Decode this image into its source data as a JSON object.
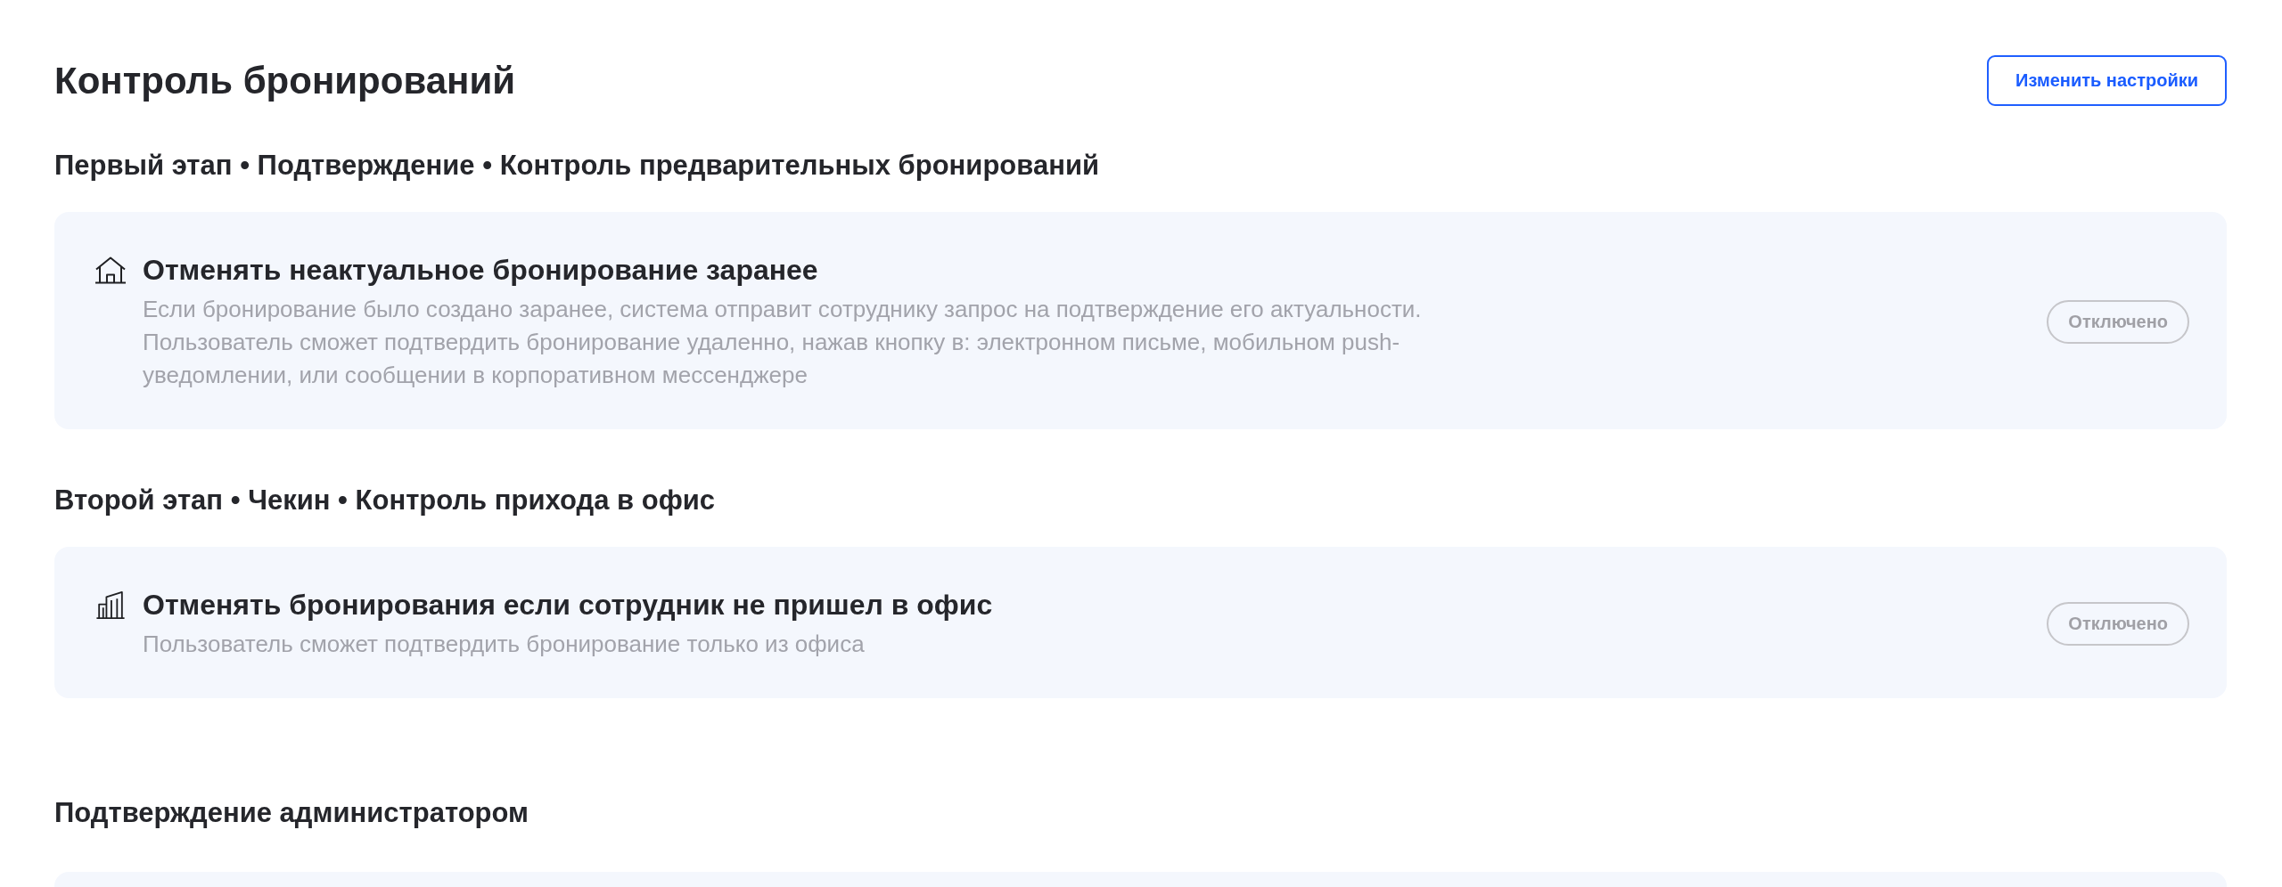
{
  "page": {
    "title": "Контроль бронирований",
    "action_button": "Изменить настройки"
  },
  "stages": [
    {
      "heading": "Первый этап • Подтверждение • Контроль предварительных бронирований",
      "cards": [
        {
          "kind": "remote",
          "title": "Отменять неактуальное бронирование заранее",
          "description": "Если бронирование было создано заранее, система отправит сотруднику запрос на подтверждение его актуальности. Пользователь сможет подтвердить бронирование удаленно, нажав кнопку в: электронном письме, мобильном push-уведомлении, или сообщении в корпоративном мессенджере",
          "status": "Отключено",
          "enabled": false
        }
      ]
    },
    {
      "heading": "Второй этап • Чекин • Контроль прихода в офис",
      "cards": [
        {
          "kind": "office",
          "title": "Отменять бронирования если сотрудник не пришел в офис",
          "description": "Пользователь сможет подтвердить бронирование только из офиса",
          "status": "Отключено",
          "enabled": false
        }
      ]
    }
  ],
  "admin_section": {
    "heading": "Подтверждение администратором",
    "more_below": true
  }
}
